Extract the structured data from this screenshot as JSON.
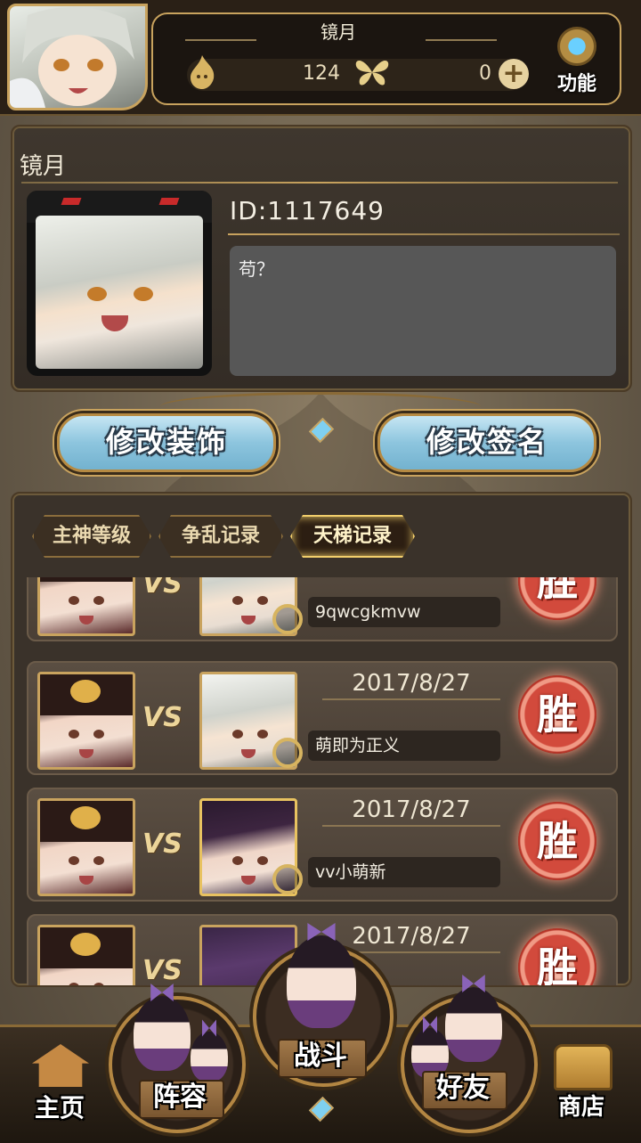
{
  "header": {
    "player_name": "镜月",
    "resource_1_icon": "flame-spirit-icon",
    "resource_1_value": "124",
    "resource_2_icon": "butterfly-icon",
    "resource_2_value": "0",
    "plus_icon": "plus-icon",
    "function_label": "功能",
    "function_icon": "gear-icon"
  },
  "profile": {
    "name": "镜月",
    "id_text": "ID:1117649",
    "signature": "苟？"
  },
  "buttons": {
    "edit_decoration": "修改装饰",
    "edit_signature": "修改签名"
  },
  "tabs": [
    {
      "label": "主神等级",
      "active": false
    },
    {
      "label": "争乱记录",
      "active": false
    },
    {
      "label": "天梯记录",
      "active": true
    }
  ],
  "records": [
    {
      "date": "",
      "opponent": "9qwcgkmvw",
      "vs": "VS",
      "result": "胜"
    },
    {
      "date": "2017/8/27",
      "opponent": "萌即为正义",
      "vs": "VS",
      "result": "胜"
    },
    {
      "date": "2017/8/27",
      "opponent": "vv小萌新",
      "vs": "VS",
      "result": "胜"
    },
    {
      "date": "2017/8/27",
      "opponent": "",
      "vs": "VS",
      "result": "胜"
    }
  ],
  "nav": {
    "home": "主页",
    "lineup": "阵容",
    "battle": "战斗",
    "friends": "好友",
    "shop": "商店"
  },
  "colors": {
    "gold_trim": "#c9a35e",
    "button_blue": "#8dc5de",
    "win_red": "#d24a3c"
  }
}
